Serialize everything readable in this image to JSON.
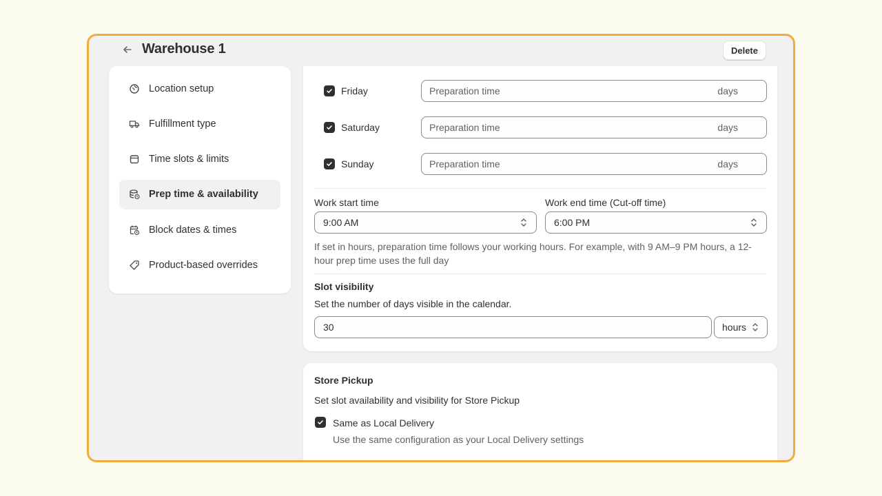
{
  "header": {
    "title": "Warehouse 1",
    "delete_label": "Delete"
  },
  "sidebar": {
    "items": [
      {
        "label": "Location setup",
        "icon": "location-icon",
        "active": false
      },
      {
        "label": "Fulfillment type",
        "icon": "truck-icon",
        "active": false
      },
      {
        "label": "Time slots & limits",
        "icon": "calendar-icon",
        "active": false
      },
      {
        "label": "Prep time & availability",
        "icon": "database-clock-icon",
        "active": true
      },
      {
        "label": "Block dates & times",
        "icon": "calendar-clock-icon",
        "active": false
      },
      {
        "label": "Product-based overrides",
        "icon": "tag-icon",
        "active": false
      }
    ]
  },
  "prep": {
    "days": [
      {
        "label": "Friday",
        "checked": true,
        "placeholder": "Preparation time",
        "suffix": "days"
      },
      {
        "label": "Saturday",
        "checked": true,
        "placeholder": "Preparation time",
        "suffix": "days"
      },
      {
        "label": "Sunday",
        "checked": true,
        "placeholder": "Preparation time",
        "suffix": "days"
      }
    ],
    "work_start_label": "Work start time",
    "work_start_value": "9:00 AM",
    "work_end_label": "Work end time (Cut-off time)",
    "work_end_value": "6:00 PM",
    "help_text": "If set in hours, preparation time follows your working hours. For example, with 9 AM–9 PM hours, a 12-hour prep time uses the full day"
  },
  "slot_visibility": {
    "title": "Slot visibility",
    "description": "Set the number of days visible in the calendar.",
    "value": "30",
    "unit": "hours"
  },
  "store_pickup": {
    "title": "Store Pickup",
    "description": "Set slot availability and visibility for Store Pickup",
    "checkbox_label": "Same as Local Delivery",
    "checkbox_checked": true,
    "checkbox_help": "Use the same configuration as your Local Delivery settings"
  },
  "colors": {
    "frame_border": "#f0ad3c",
    "page_bg": "#fcfbef",
    "checkbox": "#303030"
  }
}
